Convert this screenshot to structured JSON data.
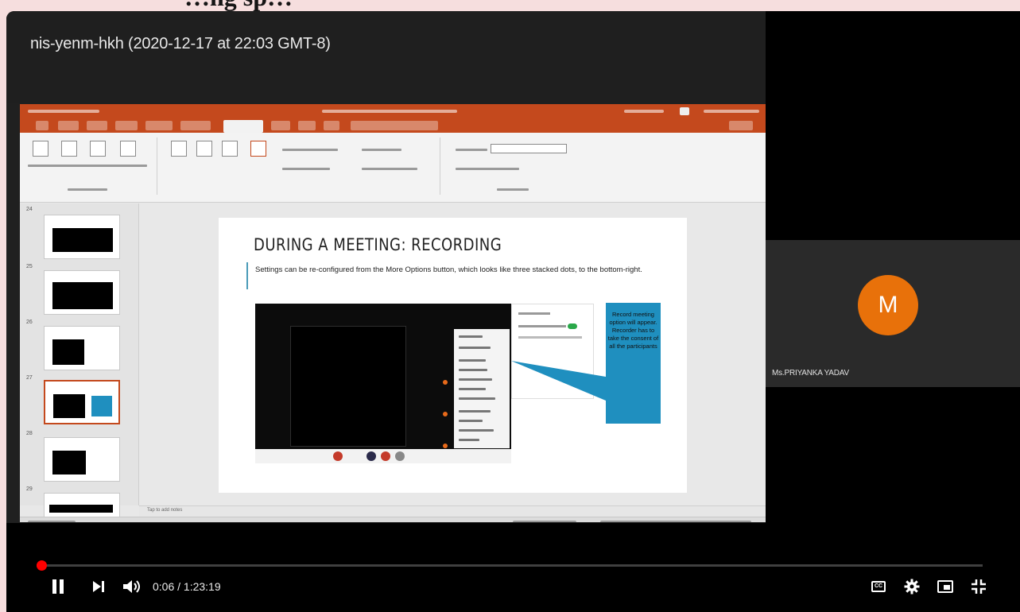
{
  "page_heading": "…ng sp…",
  "video": {
    "title": "nis-yenm-hkh (2020-12-17 at 22:03 GMT-8)",
    "time": "0:06 / 1:23:19",
    "progress_fraction": 0.0012
  },
  "slide": {
    "title": "DURING A MEETING: RECORDING",
    "body": "Settings can be re-configured from the More Options button, which looks like three stacked dots, to the bottom-right.",
    "callout": "Record meeting option will appear. Recorder has to take the consent of all the participants"
  },
  "slide_thumbnails": {
    "numbers": [
      "24",
      "25",
      "26",
      "27",
      "28",
      "29"
    ],
    "selected_index": 3
  },
  "powerpoint": {
    "notes_placeholder": "Tap to add notes"
  },
  "participant": {
    "initial": "M",
    "name": "Ms.PRIYANKA YADAV",
    "avatar_color": "#e8710a"
  },
  "controls": {
    "icons": [
      "pause-icon",
      "next-icon",
      "volume-icon",
      "captions-icon",
      "settings-icon",
      "miniplayer-icon",
      "exit-fullscreen-icon"
    ],
    "captions_label": "CC"
  },
  "colors": {
    "progress": "#ff0000",
    "powerpoint_brand": "#c4491d",
    "callout": "#1f8fbf"
  }
}
